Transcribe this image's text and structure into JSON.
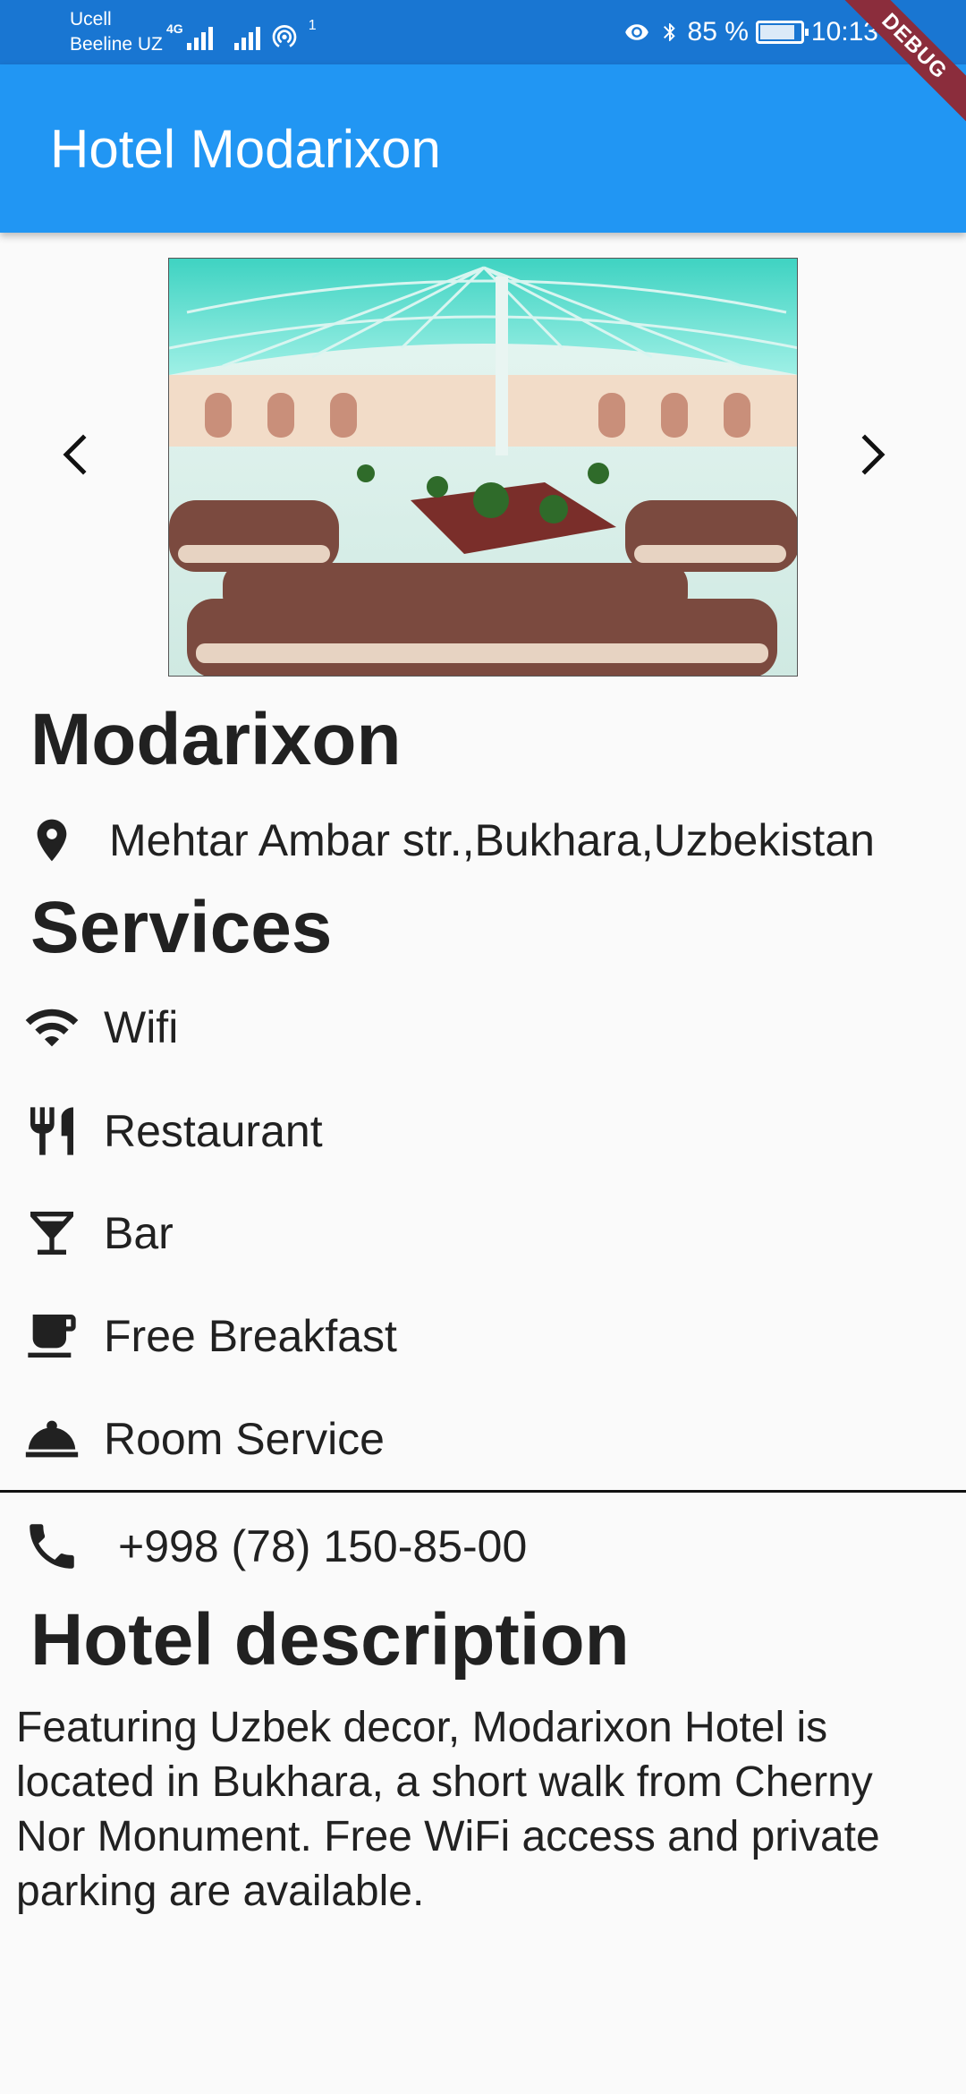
{
  "status_bar": {
    "carrier_1": "Ucell",
    "carrier_2": "Beeline UZ",
    "network_type": "4G",
    "hotspot_count": "1",
    "battery": "85 %",
    "time": "10:13",
    "debug_label": "DEBUG"
  },
  "app_bar": {
    "title": "Hotel Modarixon"
  },
  "hotel": {
    "name": "Modarixon",
    "address": "Mehtar Ambar str.,Bukhara,Uzbekistan",
    "phone": "+998 (78) 150-85-00"
  },
  "services": {
    "heading": "Services",
    "items": [
      {
        "label": "Wifi",
        "icon": "wifi-icon"
      },
      {
        "label": "Restaurant",
        "icon": "restaurant-icon"
      },
      {
        "label": "Bar",
        "icon": "bar-icon"
      },
      {
        "label": "Free Breakfast",
        "icon": "coffee-icon"
      },
      {
        "label": "Room Service",
        "icon": "room-service-icon"
      }
    ]
  },
  "description": {
    "heading": "Hotel description",
    "text": "Featuring Uzbek decor, Modarixon Hotel is located in Bukhara, a short walk from Cherny Nor Monument. Free WiFi access and private parking are available."
  },
  "colors": {
    "app_bar": "#2196f3",
    "status_bar": "#1976d2",
    "debug_ribbon": "#8b2d3c"
  }
}
